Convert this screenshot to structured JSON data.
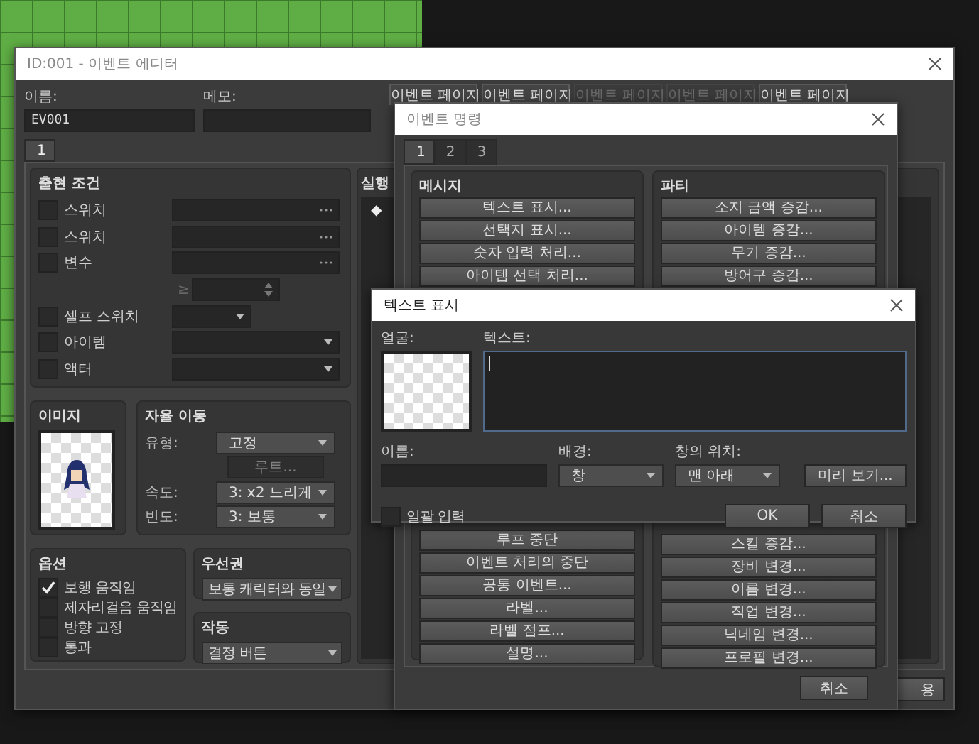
{
  "event_editor": {
    "title": "ID:001 - 이벤트 에디터",
    "name_label": "이름:",
    "name_value": "EV001",
    "memo_label": "메모:",
    "page_tabs": [
      {
        "label": "이벤트 페이지",
        "disabled": false
      },
      {
        "label": "이벤트 페이지",
        "disabled": false
      },
      {
        "label": "이벤트 페이지",
        "disabled": true
      },
      {
        "label": "이벤트 페이지",
        "disabled": true
      },
      {
        "label": "이벤트 페이지",
        "disabled": false
      }
    ],
    "page_number_tabs": [
      {
        "label": "1",
        "selected": true
      }
    ],
    "conditions": {
      "title": "출현 조건",
      "rows": [
        {
          "kind": "picker",
          "label": "스위치",
          "checked": false
        },
        {
          "kind": "picker",
          "label": "스위치",
          "checked": false
        },
        {
          "kind": "picker",
          "label": "변수",
          "checked": false
        },
        {
          "kind": "number",
          "operator": "≥"
        },
        {
          "kind": "small_dropdown",
          "label": "셀프 스위치",
          "checked": false
        },
        {
          "kind": "dropdown",
          "label": "아이템",
          "checked": false
        },
        {
          "kind": "dropdown",
          "label": "액터",
          "checked": false
        }
      ]
    },
    "image": {
      "title": "이미지"
    },
    "movement": {
      "title": "자율 이동",
      "type_label": "유형:",
      "type_value": "고정",
      "route_button": "루트...",
      "route_disabled": true,
      "speed_label": "속도:",
      "speed_value": "3: x2 느리게",
      "frequency_label": "빈도:",
      "frequency_value": "3: 보통"
    },
    "options": {
      "title": "옵션",
      "items": [
        {
          "label": "보행 움직임",
          "checked": true
        },
        {
          "label": "제자리걸음 움직임",
          "checked": false
        },
        {
          "label": "방향 고정",
          "checked": false
        },
        {
          "label": "통과",
          "checked": false
        }
      ]
    },
    "priority": {
      "title": "우선권",
      "value": "보통 캐릭터와 동일"
    },
    "trigger": {
      "title": "작동",
      "value": "결정 버튼"
    },
    "contents": {
      "title": "실행",
      "lines": [
        "◆"
      ]
    },
    "apply_button": "용"
  },
  "event_commands": {
    "title": "이벤트 명령",
    "tabs": [
      {
        "label": "1",
        "selected": true
      },
      {
        "label": "2",
        "selected": false
      },
      {
        "label": "3",
        "selected": false
      }
    ],
    "groups": [
      {
        "title": "메시지",
        "top": [
          "텍스트 표시...",
          "선택지 표시...",
          "숫자 입력 처리...",
          "아이템 선택 처리..."
        ],
        "bottom": [
          "루프 중단",
          "이벤트 처리의 중단",
          "공통 이벤트...",
          "라벨...",
          "라벨 점프...",
          "설명..."
        ]
      },
      {
        "title": "파티",
        "top": [
          "소지 금액 증감...",
          "아이템 증감...",
          "무기 증감...",
          "방어구 증감..."
        ],
        "bottom": [
          "스킬 증감...",
          "장비 변경...",
          "이름 변경...",
          "직업 변경...",
          "닉네임 변경...",
          "프로필 변경..."
        ]
      }
    ],
    "cancel_button": "취소"
  },
  "show_text_dialog": {
    "title": "텍스트 표시",
    "face_label": "얼굴:",
    "text_label": "텍스트:",
    "name_label": "이름:",
    "background_label": "배경:",
    "background_value": "창",
    "position_label": "창의 위치:",
    "position_value": "맨 아래",
    "preview_button": "미리 보기...",
    "batch_entry": {
      "label": "일괄 입력",
      "checked": false
    },
    "ok_button": "OK",
    "cancel_button": "취소"
  }
}
